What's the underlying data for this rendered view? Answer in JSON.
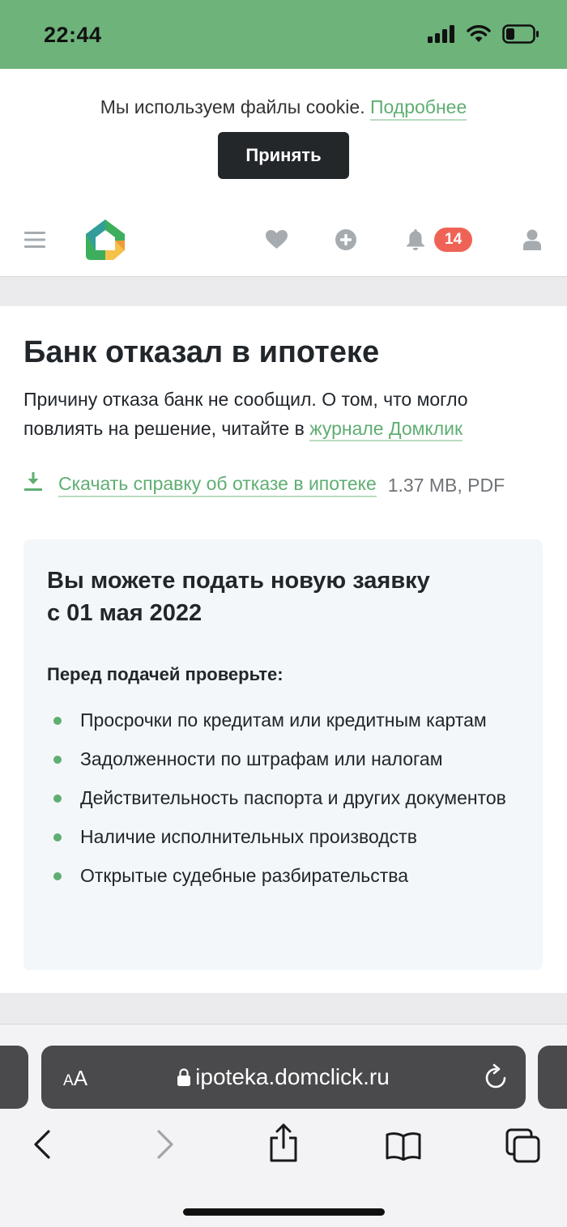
{
  "status_bar": {
    "time": "22:44"
  },
  "cookie_banner": {
    "text": "Мы используем файлы cookie.",
    "link": "Подробнее",
    "accept_button": "Принять"
  },
  "header": {
    "notifications_count": "14"
  },
  "card": {
    "title": "Банк отказал в ипотеке",
    "description": "Причину отказа банк не сообщил. О том, что могло повлиять на решение, читайте в",
    "journal_link": "журнале Домклик",
    "download": {
      "label": "Скачать справку об отказе в ипотеке",
      "size": "1.37 MB, PDF"
    },
    "info": {
      "title_line1": "Вы можете подать новую заявку",
      "title_line2": "с 01 мая 2022",
      "check_title": "Перед подачей проверьте:",
      "items": [
        "Просрочки по кредитам или кредитным картам",
        "Задолженности по штрафам или налогам",
        "Действительность паспорта и других документов",
        "Наличие исполнительных производств",
        "Открытые судебные разбирательства"
      ]
    }
  },
  "browser": {
    "aa_small": "A",
    "aa_large": "A",
    "url": "ipoteka.domclick.ru"
  },
  "colors": {
    "accent": "#5fae72",
    "status_bar": "#6db37a",
    "badge": "#ef6356"
  }
}
